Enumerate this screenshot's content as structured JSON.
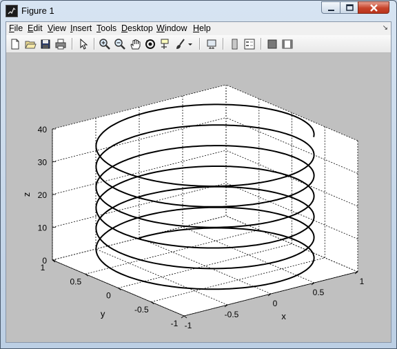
{
  "window": {
    "title": "Figure 1"
  },
  "menubar": {
    "items": [
      {
        "label": "File",
        "mnemonic": "F",
        "rest": "ile"
      },
      {
        "label": "Edit",
        "mnemonic": "E",
        "rest": "dit"
      },
      {
        "label": "View",
        "mnemonic": "V",
        "rest": "iew"
      },
      {
        "label": "Insert",
        "mnemonic": "I",
        "rest": "nsert"
      },
      {
        "label": "Tools",
        "mnemonic": "T",
        "rest": "ools"
      },
      {
        "label": "Desktop",
        "mnemonic": "D",
        "rest": "esktop"
      },
      {
        "label": "Window",
        "mnemonic": "W",
        "rest": "indow"
      },
      {
        "label": "Help",
        "mnemonic": "H",
        "rest": "elp"
      }
    ]
  },
  "toolbar": {
    "icons": [
      "new-figure-icon",
      "open-file-icon",
      "save-icon",
      "print-icon",
      "pointer-icon",
      "zoom-in-icon",
      "zoom-out-icon",
      "pan-hand-icon",
      "rotate-3d-icon",
      "data-cursor-icon",
      "brush-icon",
      "brush-dropdown-icon",
      "link-plot-icon",
      "colorbar-icon",
      "legend-icon",
      "hide-plot-tools-icon",
      "show-plot-tools-icon"
    ]
  },
  "chart_data": {
    "type": "line3d",
    "description_of_series": "helix",
    "x": "sin(t)",
    "y": "cos(t)",
    "z": "t",
    "t_range": [
      0,
      40
    ],
    "xlabel": "x",
    "ylabel": "y",
    "zlabel": "z",
    "xlim": [
      -1,
      1
    ],
    "ylim": [
      -1,
      1
    ],
    "zlim": [
      0,
      40
    ],
    "xticks": [
      "-1",
      "-0.5",
      "0",
      "0.5",
      "1"
    ],
    "yticks": [
      "-1",
      "-0.5",
      "0",
      "0.5",
      "1"
    ],
    "zticks": [
      "0",
      "10",
      "20",
      "30",
      "40"
    ],
    "grid": true,
    "box": false,
    "line_color": "#000000"
  }
}
